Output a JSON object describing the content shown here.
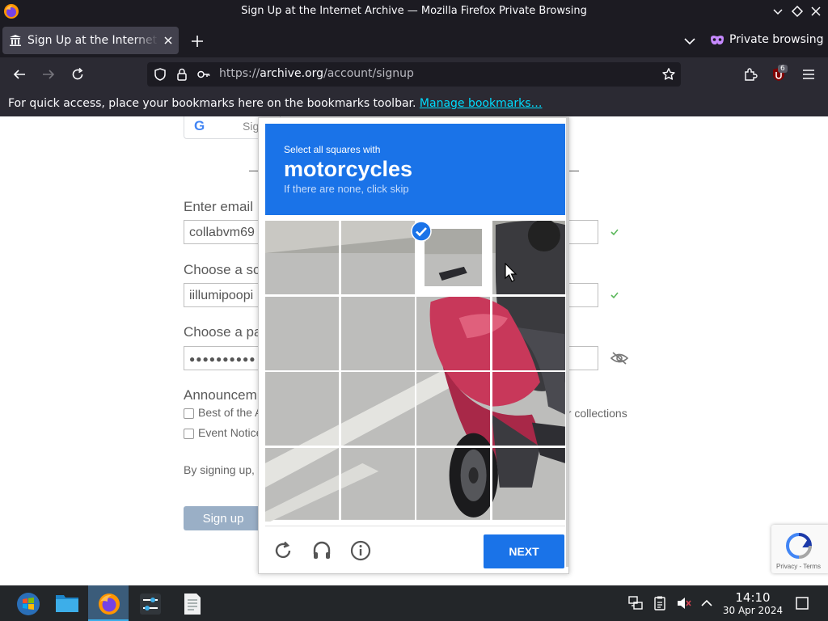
{
  "window": {
    "title": "Sign Up at the Internet Archive — Mozilla Firefox Private Browsing"
  },
  "tabs": {
    "active_title": "Sign Up at the Internet Archive",
    "private_label": "Private browsing"
  },
  "urlbar": {
    "scheme": "https://",
    "host": "archive.org",
    "path": "/account/signup"
  },
  "extensions": {
    "ublock_badge": "6"
  },
  "bookmarks": {
    "message": "For quick access, place your bookmarks here on the bookmarks toolbar.",
    "manage_link": "Manage bookmarks…"
  },
  "page": {
    "google_button_text": "Sig",
    "email_label": "Enter email",
    "email_value": "collabvm69",
    "screenname_label": "Choose a sc",
    "screenname_value": "iillumipoopi",
    "password_label": "Choose a pa",
    "password_value": "●●●●●●●●●●",
    "announcements_label": "Announcem",
    "checkbox1_label": "Best of the A",
    "checkbox2_label": "Event Notice",
    "collections_text": "ur collections",
    "terms_text": "By signing up, y",
    "signup_button": "Sign up"
  },
  "recaptcha_badge": {
    "links": "Privacy - Terms"
  },
  "challenge": {
    "instruction": "Select all squares with",
    "target": "motorcycles",
    "hint": "If there are none, click skip",
    "next_button": "NEXT",
    "selected_tiles": [
      2
    ]
  },
  "taskbar": {
    "time": "14:10",
    "date": "30 Apr 2024"
  },
  "colors": {
    "recaptcha_blue": "#1a73e8",
    "firefox_dark": "#1c1b22",
    "toolbar": "#2b2a33",
    "taskbar": "#232629"
  }
}
